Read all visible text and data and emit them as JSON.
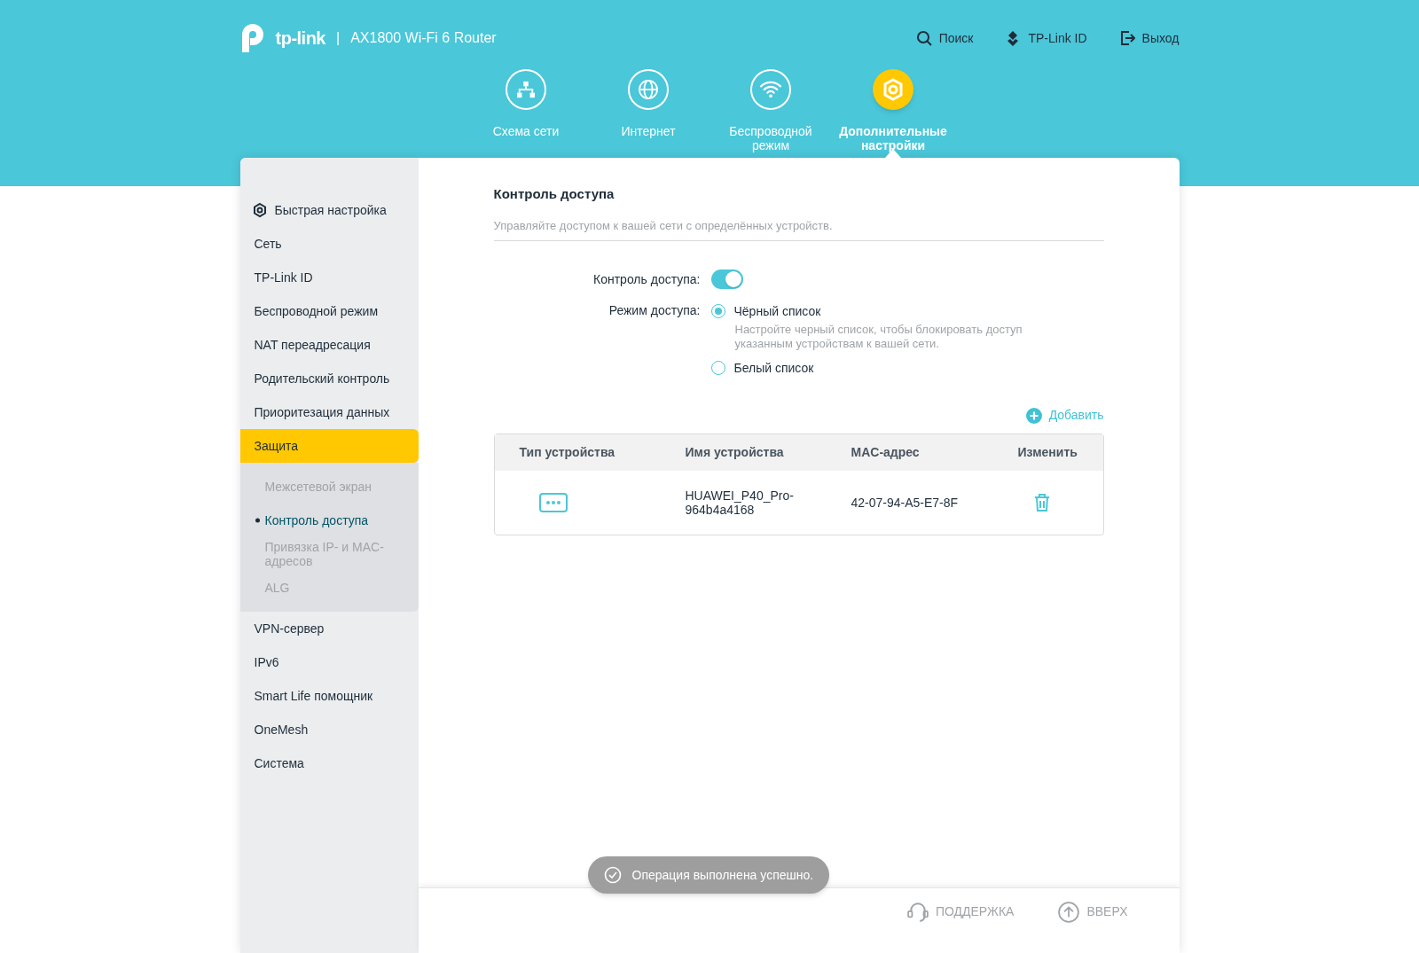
{
  "header": {
    "logo_text": "tp-link",
    "separator": "|",
    "model": "AX1800 Wi-Fi 6 Router",
    "links": [
      {
        "kind": "search",
        "label": "Поиск"
      },
      {
        "kind": "id",
        "label": "TP-Link ID"
      },
      {
        "kind": "logout",
        "label": "Выход"
      }
    ]
  },
  "nav_tabs": [
    {
      "kind": "network",
      "label": "Схема сети",
      "selected": false
    },
    {
      "kind": "internet",
      "label": "Интернет",
      "selected": false
    },
    {
      "kind": "wireless",
      "label": "Беспроводной режим",
      "selected": false
    },
    {
      "kind": "advanced",
      "label": "Дополнительные настройки",
      "selected": true
    }
  ],
  "sidebar": {
    "items": [
      {
        "kind": "quick",
        "label": "Быстрая настройка",
        "selected": false
      },
      {
        "label": "Сеть",
        "selected": false
      },
      {
        "label": "TP-Link ID",
        "selected": false
      },
      {
        "label": "Беспроводной режим",
        "selected": false
      },
      {
        "label": "NAT переадресация",
        "selected": false
      },
      {
        "label": "Родительский контроль",
        "selected": false
      },
      {
        "label": "Приоритезация данных",
        "selected": false
      },
      {
        "label": "Защита",
        "selected": true,
        "expanded": true,
        "children": [
          {
            "label": "Межсетевой экран",
            "selected": false
          },
          {
            "label": "Контроль доступа",
            "selected": true
          },
          {
            "label": "Привязка IP- и MAC-адресов",
            "selected": false
          },
          {
            "label": "ALG",
            "selected": false
          }
        ]
      },
      {
        "label": "VPN-сервер",
        "selected": false
      },
      {
        "label": "IPv6",
        "selected": false
      },
      {
        "label": "Smart Life помощник",
        "selected": false
      },
      {
        "label": "OneMesh",
        "selected": false
      },
      {
        "label": "Система",
        "selected": false
      }
    ]
  },
  "content": {
    "title": "Контроль доступа",
    "description": "Управляйте доступом к вашей сети с определённых устройств.",
    "toggle": {
      "label": "Контроль доступа:",
      "on": true
    },
    "access_mode": {
      "label": "Режим доступа:",
      "options": [
        {
          "label": "Чёрный список",
          "selected": true,
          "hint": "Настройте черный список, чтобы блокировать доступ указанным устройствам к вашей сети."
        },
        {
          "label": "Белый список",
          "selected": false
        }
      ]
    },
    "add_button": "Добавить",
    "table": {
      "columns": [
        "Тип устройства",
        "Имя устройства",
        "MAC-адрес",
        "Изменить"
      ],
      "rows": [
        {
          "device_name": "HUAWEI_P40_Pro-964b4a4168",
          "mac": "42-07-94-A5-E7-8F"
        }
      ]
    }
  },
  "toast": "Операция выполнена успешно.",
  "footer": {
    "links": [
      {
        "kind": "support",
        "label": "ПОДДЕРЖКА"
      },
      {
        "kind": "top",
        "label": "ВВЕРХ"
      }
    ]
  }
}
